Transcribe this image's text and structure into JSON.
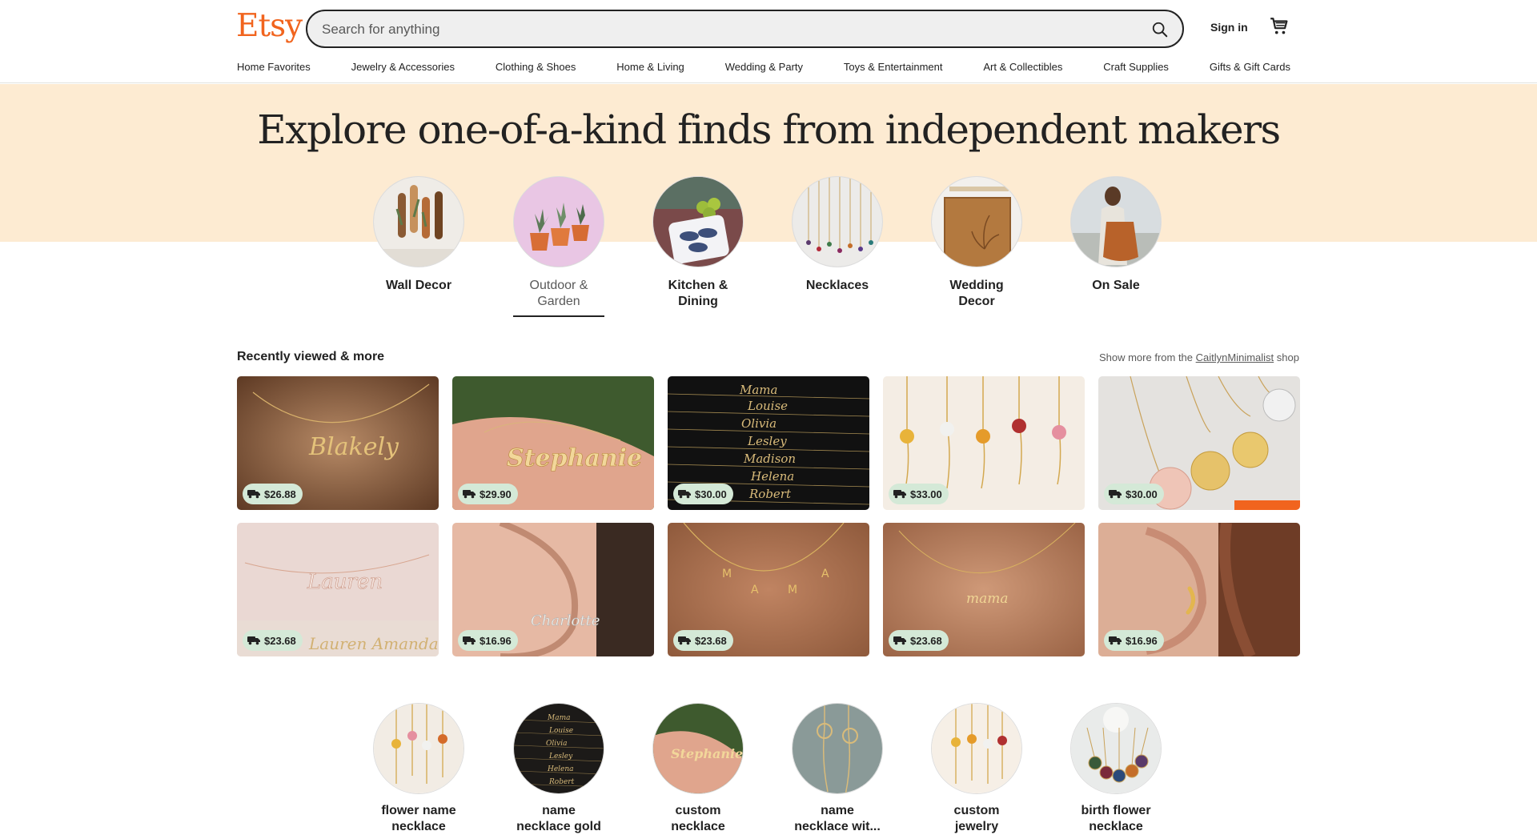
{
  "header": {
    "logo": "Etsy",
    "search_placeholder": "Search for anything",
    "sign_in": "Sign in",
    "cart_icon": "cart-icon",
    "search_icon": "search-icon",
    "brand_color": "#F1641E"
  },
  "nav": {
    "items": [
      "Home Favorites",
      "Jewelry & Accessories",
      "Clothing & Shoes",
      "Home & Living",
      "Wedding & Party",
      "Toys & Entertainment",
      "Art & Collectibles",
      "Craft Supplies",
      "Gifts & Gift Cards"
    ]
  },
  "hero": {
    "title": "Explore one-of-a-kind finds from independent makers",
    "bg_color": "#FDEBD2",
    "categories": [
      {
        "label": "Wall Decor",
        "active": false
      },
      {
        "label": "Outdoor & Garden",
        "active": true
      },
      {
        "label": "Kitchen & Dining",
        "active": false
      },
      {
        "label": "Necklaces",
        "active": false
      },
      {
        "label": "Wedding Decor",
        "active": false
      },
      {
        "label": "On Sale",
        "active": false
      }
    ]
  },
  "recently_viewed": {
    "title": "Recently viewed & more",
    "more_prefix": "Show more from the",
    "shop_name": "CaitlynMinimalist",
    "more_suffix": "shop",
    "items": [
      {
        "price": "$26.88"
      },
      {
        "price": "$29.90"
      },
      {
        "price": "$30.00"
      },
      {
        "price": "$33.00"
      },
      {
        "price": "$30.00"
      },
      {
        "price": "$23.68"
      },
      {
        "price": "$16.96"
      },
      {
        "price": "$23.68"
      },
      {
        "price": "$23.68"
      },
      {
        "price": "$16.96"
      }
    ],
    "price_badge_color": "#D4E9D7"
  },
  "recommendations": {
    "items": [
      {
        "label_line1": "flower name",
        "label_line2": "necklace"
      },
      {
        "label_line1": "name",
        "label_line2": "necklace gold"
      },
      {
        "label_line1": "custom",
        "label_line2": "necklace"
      },
      {
        "label_line1": "name",
        "label_line2": "necklace wit..."
      },
      {
        "label_line1": "custom",
        "label_line2": "jewelry"
      },
      {
        "label_line1": "birth flower",
        "label_line2": "necklace"
      }
    ]
  }
}
